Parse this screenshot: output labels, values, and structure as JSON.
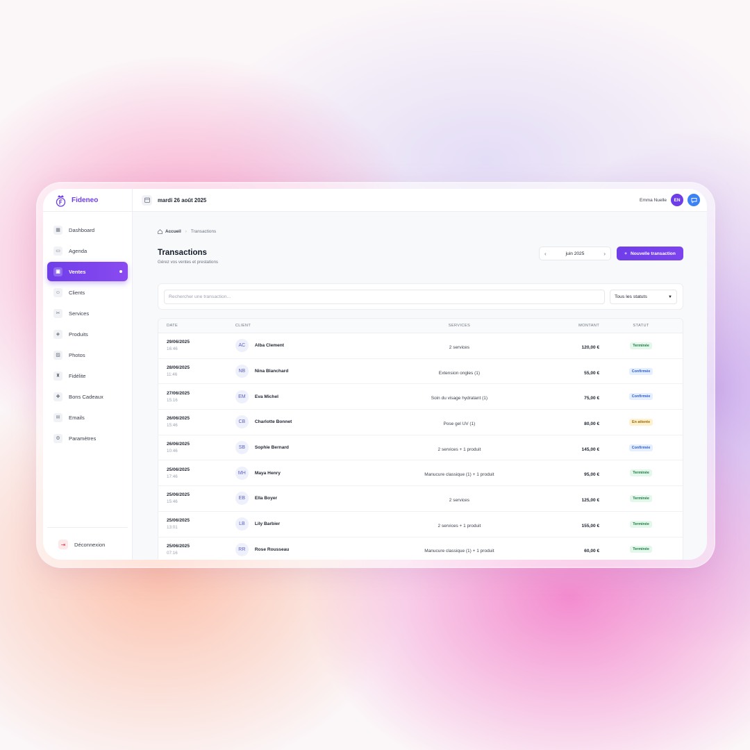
{
  "app": {
    "name": "Fideneo"
  },
  "colors": {
    "accent": "#6d3ee8",
    "chat": "#3b82f6",
    "done": "#1f7a44",
    "confirmed": "#2f5fc9",
    "pending": "#9a6a07"
  },
  "sidebar": {
    "items": [
      {
        "label": "Dashboard",
        "icon": "dashboard-icon"
      },
      {
        "label": "Agenda",
        "icon": "calendar-icon"
      },
      {
        "label": "Ventes",
        "icon": "cash-icon",
        "active": true
      },
      {
        "label": "Clients",
        "icon": "users-icon"
      },
      {
        "label": "Services",
        "icon": "scissors-icon"
      },
      {
        "label": "Produits",
        "icon": "box-icon"
      },
      {
        "label": "Photos",
        "icon": "image-icon"
      },
      {
        "label": "Fidélite",
        "icon": "trophy-icon"
      },
      {
        "label": "Bons Cadeaux",
        "icon": "gift-icon"
      },
      {
        "label": "Emails",
        "icon": "mail-icon"
      },
      {
        "label": "Paramètres",
        "icon": "gear-icon"
      }
    ],
    "logout": "Déconnexion"
  },
  "topbar": {
    "date": "mardi 26 août 2025",
    "user_name": "Emma Nuelle",
    "user_initials": "EN"
  },
  "breadcrumb": {
    "home": "Accueil",
    "current": "Transactions"
  },
  "page": {
    "title": "Transactions",
    "subtitle": "Gérez vos ventes et prestations",
    "month": "juin 2025",
    "new_button": "Nouvelle transaction"
  },
  "filters": {
    "search_placeholder": "Rechercher une transaction...",
    "status_value": "Tous les statuts"
  },
  "table": {
    "headers": {
      "date": "DATE",
      "client": "CLIENT",
      "services": "SERVICES",
      "amount": "MONTANT",
      "status": "STATUT"
    },
    "rows": [
      {
        "date": "29/06/2025",
        "time": "16:46",
        "initials": "AC",
        "client": "Alba Clement",
        "services": "2 services",
        "amount": "120,00 €",
        "status": "Terminée",
        "kind": "done"
      },
      {
        "date": "28/06/2025",
        "time": "11:46",
        "initials": "NB",
        "client": "Nina Blanchard",
        "services": "Extension ongles (1)",
        "amount": "55,00 €",
        "status": "Confirmée",
        "kind": "conf"
      },
      {
        "date": "27/06/2025",
        "time": "15:16",
        "initials": "EM",
        "client": "Eva Michel",
        "services": "Soin du visage hydratant (1)",
        "amount": "75,00 €",
        "status": "Confirmée",
        "kind": "conf"
      },
      {
        "date": "26/06/2025",
        "time": "15:46",
        "initials": "CB",
        "client": "Charlotte Bonnet",
        "services": "Pose gel UV (1)",
        "amount": "80,00 €",
        "status": "En attente",
        "kind": "wait"
      },
      {
        "date": "26/06/2025",
        "time": "10:46",
        "initials": "SB",
        "client": "Sophie Bernard",
        "services": "2 services + 1 produit",
        "amount": "145,00 €",
        "status": "Confirmée",
        "kind": "conf"
      },
      {
        "date": "25/06/2025",
        "time": "17:46",
        "initials": "MH",
        "client": "Maya Henry",
        "services": "Manucure classique (1) + 1 produit",
        "amount": "95,00 €",
        "status": "Terminée",
        "kind": "done"
      },
      {
        "date": "25/06/2025",
        "time": "15:46",
        "initials": "EB",
        "client": "Ella Boyer",
        "services": "2 services",
        "amount": "125,00 €",
        "status": "Terminée",
        "kind": "done"
      },
      {
        "date": "25/06/2025",
        "time": "13:01",
        "initials": "LB",
        "client": "Lily Barbier",
        "services": "2 services + 1 produit",
        "amount": "155,00 €",
        "status": "Terminée",
        "kind": "done"
      },
      {
        "date": "25/06/2025",
        "time": "07:16",
        "initials": "RR",
        "client": "Rose Rousseau",
        "services": "Manucure classique (1) + 1 produit",
        "amount": "60,00 €",
        "status": "Terminée",
        "kind": "done"
      }
    ]
  }
}
